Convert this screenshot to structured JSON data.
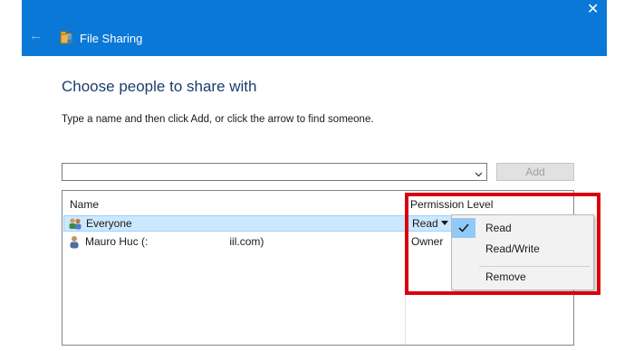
{
  "window": {
    "title": "File Sharing",
    "close_glyph": "✕",
    "back_glyph": "←"
  },
  "heading": "Choose people to share with",
  "instruction": "Type a name and then click Add, or click the arrow to find someone.",
  "combo": {
    "value": ""
  },
  "add_button": "Add",
  "list": {
    "columns": [
      "Name",
      "Permission Level"
    ],
    "rows": [
      {
        "name": "Everyone",
        "permission": "Read",
        "icon": "group-icon",
        "selected": true
      },
      {
        "name": "Mauro Huc (:                           iil.com)",
        "permission": "Owner",
        "icon": "user-icon",
        "selected": false
      }
    ]
  },
  "menu": {
    "items": [
      {
        "label": "Read",
        "checked": true
      },
      {
        "label": "Read/Write",
        "checked": false
      },
      {
        "label": "Remove",
        "checked": false
      }
    ]
  },
  "colors": {
    "titlebar": "#0a78d7",
    "selection": "#cce8ff",
    "annotation": "#d9000d"
  }
}
